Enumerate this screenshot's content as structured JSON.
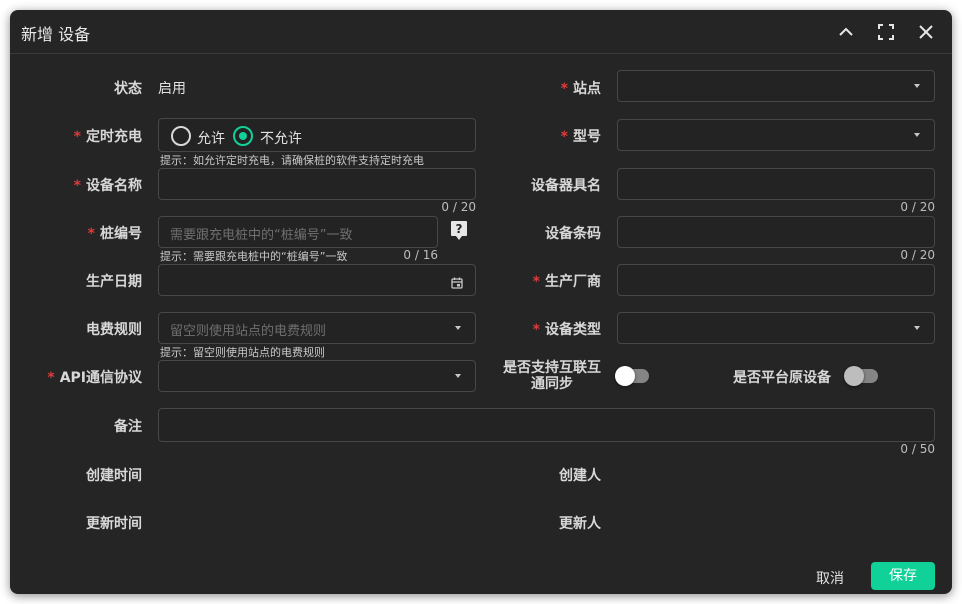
{
  "dialog": {
    "title": "新增 设备",
    "icons": [
      "chevron-up-icon",
      "fullscreen-icon",
      "close-icon"
    ]
  },
  "colors": {
    "accent": "#10d197",
    "required": "#e03a3a",
    "background": "#252525"
  },
  "form": {
    "status": {
      "label": "状态",
      "value": "启用"
    },
    "station": {
      "label": "站点",
      "value": ""
    },
    "timed_charging": {
      "label": "定时充电",
      "options": [
        "允许",
        "不允许"
      ],
      "selected": "不允许",
      "hint": "提示：如允许定时充电，请确保桩的软件支持定时充电"
    },
    "model": {
      "label": "型号",
      "value": ""
    },
    "device_name": {
      "label": "设备名称",
      "value": "",
      "counter": "0 / 20"
    },
    "device_fixture_name": {
      "label": "设备器具名",
      "value": "",
      "counter": "0 / 20"
    },
    "pile_number": {
      "label": "桩编号",
      "placeholder": "需要跟充电桩中的“桩编号”一致",
      "hint": "提示：需要跟充电桩中的“桩编号”一致",
      "counter": "0 / 16",
      "help_icon": "help-icon"
    },
    "device_barcode": {
      "label": "设备条码",
      "value": "",
      "counter": "0 / 20"
    },
    "production_date": {
      "label": "生产日期",
      "value": ""
    },
    "manufacturer": {
      "label": "生产厂商",
      "value": ""
    },
    "tariff_rule": {
      "label": "电费规则",
      "placeholder": "留空则使用站点的电费规则",
      "hint": "提示：留空则使用站点的电费规则"
    },
    "device_type": {
      "label": "设备类型",
      "value": ""
    },
    "api_protocol": {
      "label": "API通信协议",
      "value": ""
    },
    "interop_sync": {
      "label_line1": "是否支持互联互",
      "label_line2": "通同步",
      "on": false
    },
    "platform_original": {
      "label": "是否平台原设备",
      "on": false
    },
    "remark": {
      "label": "备注",
      "value": "",
      "counter": "0 / 50"
    },
    "created_time": {
      "label": "创建时间",
      "value": ""
    },
    "creator": {
      "label": "创建人",
      "value": ""
    },
    "updated_time": {
      "label": "更新时间",
      "value": ""
    },
    "updater": {
      "label": "更新人",
      "value": ""
    }
  },
  "footer": {
    "cancel_label": "取消",
    "save_label": "保存"
  }
}
